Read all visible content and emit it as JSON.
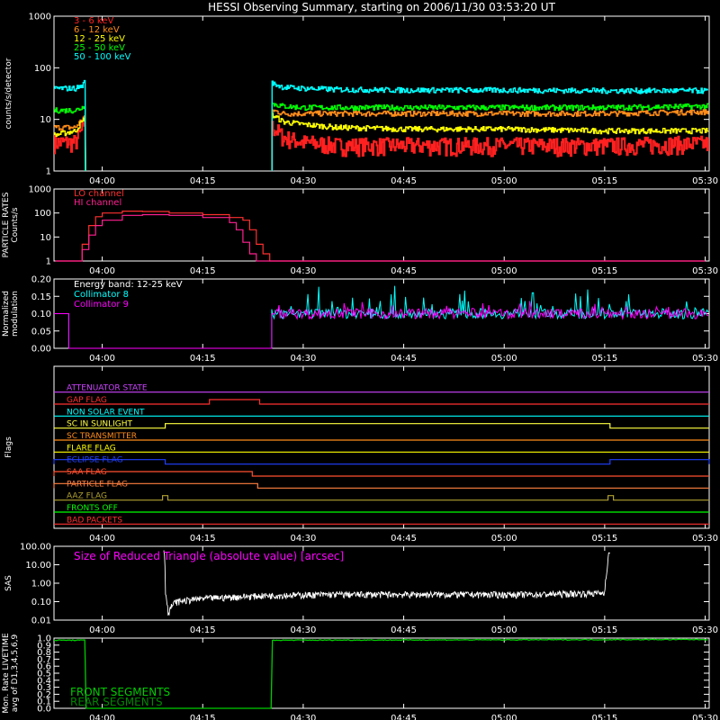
{
  "title": "HESSI Observing Summary, starting on 2006/11/30 03:53:20 UT",
  "time_ticks": [
    "04:00",
    "04:15",
    "04:30",
    "04:45",
    "05:00",
    "05:15",
    "05:30"
  ],
  "time_tick_minutes": [
    0,
    15,
    30,
    45,
    60,
    75,
    90
  ],
  "time_range_minutes": [
    -7.2,
    90.6
  ],
  "colors": {
    "bg": "#000000",
    "axis": "#ffffff",
    "band_3_6": "#ff2020",
    "band_6_12": "#ff8c1a",
    "band_12_25": "#ffff00",
    "band_25_50": "#00ff00",
    "band_50_100": "#00ffff",
    "lo_channel": "#ff3030",
    "hi_channel": "#ff2090",
    "col8": "#00ffff",
    "col9": "#ff00ff",
    "sas": "#ffffff",
    "livetime": "#00cc00"
  },
  "chart_data": [
    {
      "type": "line",
      "ylabel": "counts/s/detector",
      "yscale": "log",
      "ylim": [
        1,
        1000
      ],
      "yticks": [
        "1",
        "10",
        "100",
        "1000"
      ],
      "x_unit": "minutes from 04:00 UT",
      "gap": [
        -2.5,
        25.3
      ],
      "series": [
        {
          "name": "3 - 6 keV",
          "color": "#ff2020",
          "x": [
            -7,
            -4,
            -3,
            -2.6,
            25.4,
            27,
            30,
            35,
            45,
            60,
            75,
            90
          ],
          "y": [
            4,
            4,
            7,
            10,
            8,
            5,
            4,
            3.5,
            3.5,
            3.5,
            3.5,
            3.8
          ]
        },
        {
          "name": "6 - 12 keV",
          "color": "#ff8c1a",
          "x": [
            -7,
            -4,
            -3,
            -2.6,
            25.4,
            27,
            30,
            35,
            45,
            60,
            75,
            90
          ],
          "y": [
            7,
            7,
            10,
            12,
            15,
            13,
            13,
            13,
            13,
            13,
            13,
            14
          ]
        },
        {
          "name": "12 - 25 keV",
          "color": "#ffff00",
          "x": [
            -7,
            -4,
            -3,
            -2.6,
            25.4,
            27,
            30,
            35,
            45,
            60,
            75,
            90
          ],
          "y": [
            5,
            6,
            9,
            11,
            12,
            9,
            8,
            7,
            6.5,
            6.5,
            6,
            6
          ]
        },
        {
          "name": "25 - 50 keV",
          "color": "#00ff00",
          "x": [
            -7,
            -4,
            -3,
            -2.6,
            25.4,
            27,
            30,
            35,
            45,
            60,
            75,
            90
          ],
          "y": [
            15,
            15,
            17,
            20,
            20,
            18,
            17,
            17,
            17,
            17,
            17,
            18
          ]
        },
        {
          "name": "50 - 100 keV",
          "color": "#00ffff",
          "x": [
            -7,
            -4,
            -3,
            -2.6,
            25.4,
            27,
            30,
            35,
            45,
            60,
            75,
            90
          ],
          "y": [
            40,
            40,
            45,
            55,
            50,
            42,
            40,
            38,
            37,
            37,
            36,
            36
          ]
        }
      ]
    },
    {
      "type": "line",
      "ylabel": "PARTICLE RATES Counts/s",
      "yscale": "log",
      "ylim": [
        1,
        1000
      ],
      "yticks": [
        "1",
        "10",
        "100",
        "1000"
      ],
      "series": [
        {
          "name": "LO channel",
          "color": "#ff3030",
          "x": [
            -7,
            -4,
            -3,
            -2,
            -1,
            0,
            3,
            6,
            10,
            15,
            19,
            21,
            22,
            23,
            24,
            25,
            90
          ],
          "y": [
            1,
            1,
            5,
            30,
            70,
            100,
            120,
            115,
            100,
            85,
            65,
            50,
            20,
            5,
            2,
            1,
            1
          ]
        },
        {
          "name": "HI channel",
          "color": "#ff2090",
          "x": [
            -7,
            -4,
            -3,
            -2,
            -1,
            0,
            3,
            6,
            10,
            15,
            19,
            20,
            21,
            22,
            23,
            24,
            90
          ],
          "y": [
            1,
            1,
            3,
            12,
            30,
            50,
            80,
            85,
            80,
            65,
            40,
            20,
            6,
            2,
            1,
            1,
            1
          ]
        }
      ]
    },
    {
      "type": "line",
      "ylabel": "Normalized modulation",
      "ylim": [
        0,
        0.2
      ],
      "yticks": [
        "0.00",
        "0.05",
        "0.10",
        "0.15",
        "0.20"
      ],
      "annotation": "Energy band: 12-25 keV",
      "gap": [
        -5.0,
        25.3
      ],
      "series": [
        {
          "name": "Collimator 8",
          "color": "#00ffff",
          "baseline": 0.1
        },
        {
          "name": "Collimator 9",
          "color": "#ff00ff",
          "baseline": 0.1
        }
      ]
    },
    {
      "type": "flags",
      "ylabel": "Flags",
      "rows": [
        {
          "name": "ATTENUATOR STATE",
          "color": "#cc44ff",
          "segments": []
        },
        {
          "name": "GAP FLAG",
          "color": "#ff3030",
          "segments": [
            [
              16,
              23.5
            ]
          ]
        },
        {
          "name": "NON SOLAR EVENT",
          "color": "#00ffff",
          "segments": []
        },
        {
          "name": "SC IN SUNLIGHT",
          "color": "#ffff40",
          "segments": [
            [
              9.4,
              75.8
            ]
          ]
        },
        {
          "name": "SC TRANSMITTER",
          "color": "#ff8c1a",
          "segments": []
        },
        {
          "name": "FLARE FLAG",
          "color": "#ffff00",
          "segments": []
        },
        {
          "name": "ECLIPSE FLAG",
          "color": "#2040ff",
          "segments": [
            [
              -7.2,
              9.4
            ],
            [
              75.8,
              90.6
            ]
          ]
        },
        {
          "name": "SAA FLAG",
          "color": "#ff5030",
          "segments": [
            [
              -7.2,
              22.4
            ]
          ]
        },
        {
          "name": "PARTICLE FLAG",
          "color": "#ff8040",
          "segments": [
            [
              -7.2,
              23.2
            ]
          ]
        },
        {
          "name": "AAZ FLAG",
          "color": "#b0a030",
          "segments": [
            [
              9.0,
              9.8
            ],
            [
              75.5,
              76.3
            ]
          ]
        },
        {
          "name": "FRONTS OFF",
          "color": "#00ff00",
          "segments": []
        },
        {
          "name": "BAD PACKETS",
          "color": "#ff3030",
          "segments": []
        }
      ]
    },
    {
      "type": "line",
      "ylabel": "SAS",
      "yscale": "log",
      "ylim": [
        0.01,
        100
      ],
      "yticks": [
        "0.01",
        "0.10",
        "1.00",
        "10.00",
        "100.00"
      ],
      "annotation": "Size of Reduced Triangle (absolute value) [arcsec]",
      "series": [
        {
          "name": "Reduced triangle size",
          "color": "#ffffff",
          "x": [
            9.2,
            9.4,
            9.8,
            11,
            15,
            25,
            35,
            50,
            65,
            75,
            75.4,
            75.8
          ],
          "y": [
            60,
            0.3,
            0.02,
            0.1,
            0.15,
            0.22,
            0.25,
            0.25,
            0.25,
            0.3,
            5,
            60
          ]
        }
      ]
    },
    {
      "type": "line",
      "ylabel": "Mon. Rate LIVETIME avg of D1,3,4,5,6,9",
      "ylim": [
        0,
        1.0
      ],
      "yticks": [
        "0.0",
        "0.1",
        "0.2",
        "0.3",
        "0.4",
        "0.5",
        "0.6",
        "0.7",
        "0.8",
        "0.9",
        "1.0"
      ],
      "series": [
        {
          "name": "FRONT SEGMENTS",
          "color": "#00cc00",
          "x": [
            -7,
            -2.6,
            -2.5,
            25.3,
            25.4,
            90
          ],
          "y": [
            0.97,
            0.97,
            0,
            0,
            0.97,
            0.98
          ]
        },
        {
          "name": "REAR SEGMENTS",
          "color": "#008800",
          "x": [],
          "y": []
        }
      ]
    }
  ]
}
